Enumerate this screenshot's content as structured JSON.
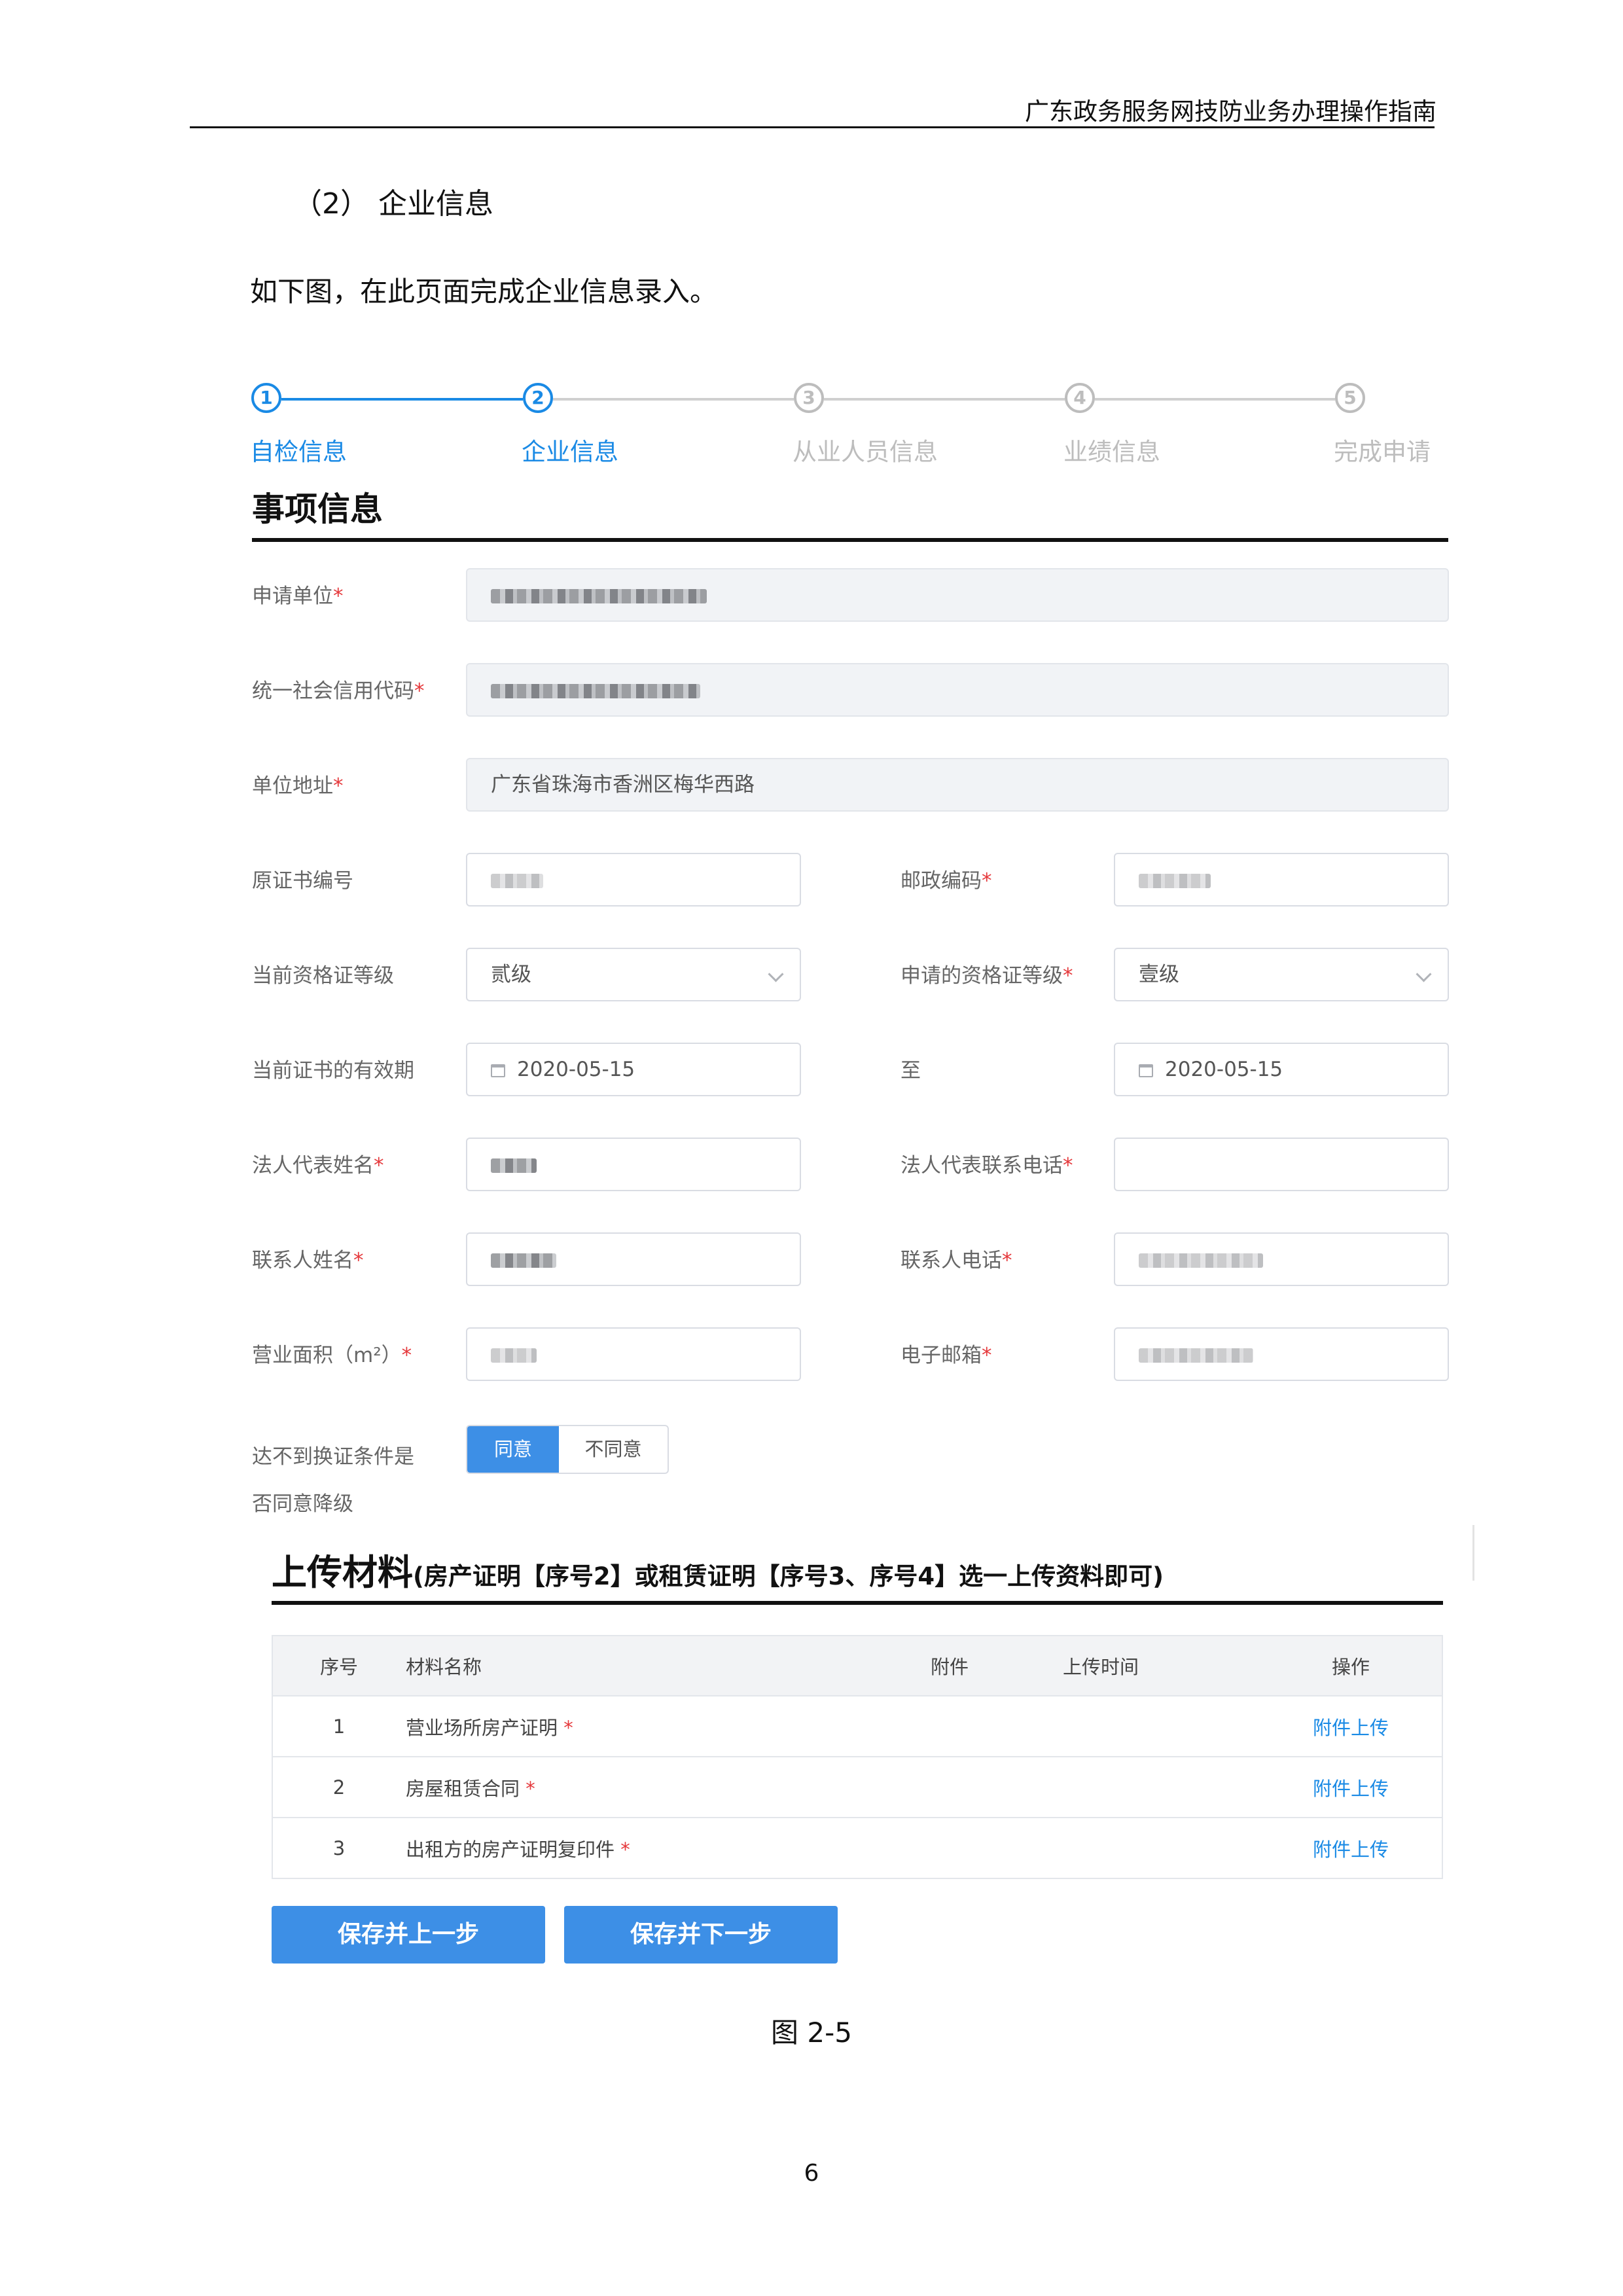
{
  "doc": {
    "header": "广东政务服务网技防业务办理操作指南",
    "section_heading": "（2）  企业信息",
    "intro": "如下图，在此页面完成企业信息录入。",
    "figure_caption": "图 2-5",
    "page_number": "6"
  },
  "stepper": {
    "steps": [
      {
        "number": "1",
        "label": "自检信息",
        "state": "done"
      },
      {
        "number": "2",
        "label": "企业信息",
        "state": "current"
      },
      {
        "number": "3",
        "label": "从业人员信息",
        "state": "todo"
      },
      {
        "number": "4",
        "label": "业绩信息",
        "state": "todo"
      },
      {
        "number": "5",
        "label": "完成申请",
        "state": "todo"
      }
    ],
    "active_color": "#1a8ae5",
    "inactive_color": "#bdbdbd"
  },
  "form": {
    "title": "事项信息",
    "required_mark": "*",
    "applicant_unit": {
      "label": "申请单位"
    },
    "credit_code": {
      "label": "统一社会信用代码"
    },
    "address": {
      "label": "单位地址",
      "value": "广东省珠海市香洲区梅华西路"
    },
    "orig_cert_no": {
      "label": "原证书编号"
    },
    "postal_code": {
      "label": "邮政编码"
    },
    "current_level": {
      "label": "当前资格证等级",
      "value": "贰级"
    },
    "applied_level": {
      "label": "申请的资格证等级",
      "value": "壹级"
    },
    "validity": {
      "label": "当前证书的有效期",
      "start": "2020-05-15",
      "to_label": "至",
      "end": "2020-05-15"
    },
    "legal_rep_name": {
      "label": "法人代表姓名"
    },
    "legal_rep_phone": {
      "label": "法人代表联系电话",
      "value": ""
    },
    "contact_name": {
      "label": "联系人姓名"
    },
    "contact_phone": {
      "label": "联系人电话"
    },
    "business_area": {
      "label": "营业面积（m²）"
    },
    "email": {
      "label": "电子邮箱"
    },
    "downgrade": {
      "label_line1": "达不到换证条件是",
      "label_line2": "否同意降级",
      "agree": "同意",
      "disagree": "不同意",
      "selected": "同意"
    }
  },
  "upload": {
    "title_main": "上传材料",
    "title_note": "(房产证明【序号2】或租赁证明【序号3、序号4】选一上传资料即可)",
    "columns": [
      "序号",
      "材料名称",
      "附件",
      "上传时间",
      "操作"
    ],
    "rows": [
      {
        "no": "1",
        "name": "营业场所房产证明",
        "action": "附件上传"
      },
      {
        "no": "2",
        "name": "房屋租赁合同",
        "action": "附件上传"
      },
      {
        "no": "3",
        "name": "出租方的房产证明复印件",
        "action": "附件上传"
      }
    ]
  },
  "buttons": {
    "prev": "保存并上一步",
    "next": "保存并下一步"
  },
  "colors": {
    "primary": "#3d8fe6",
    "required": "#e5383b",
    "link": "#1a8ae5"
  }
}
